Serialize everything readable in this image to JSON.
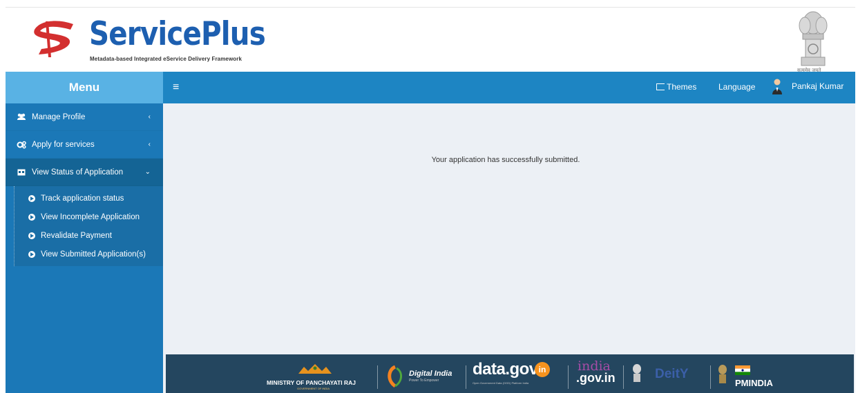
{
  "header": {
    "brand": "ServicePlus",
    "tagline": "Metadata-based Integrated eService Delivery Framework",
    "emblem_caption": "सत्यमेव जयते"
  },
  "sidebar": {
    "menu_title": "Menu",
    "items": [
      {
        "label": "Manage Profile",
        "icon": "users-icon",
        "expanded": false
      },
      {
        "label": "Apply for services",
        "icon": "gears-icon",
        "expanded": false
      },
      {
        "label": "View Status of Application",
        "icon": "window-icon",
        "expanded": true
      }
    ],
    "submenu": [
      {
        "label": "Track application status"
      },
      {
        "label": "View Incomplete Application"
      },
      {
        "label": "Revalidate Payment"
      },
      {
        "label": "View Submitted Application(s)"
      }
    ]
  },
  "topbar": {
    "themes_label": "Themes",
    "language_label": "Language",
    "user_name": "Pankaj Kumar"
  },
  "main": {
    "message": "Your application has successfully submitted."
  },
  "footer": {
    "partners": {
      "panchayati_raj": "MINISTRY OF PANCHAYATI RAJ",
      "panchayati_raj_sub": "GOVERNMENT OF INDIA",
      "digital_india": "Digital India",
      "digital_india_sub": "Power To Empower",
      "datagov": "data.gov",
      "datagov_badge": "in",
      "datagov_sub": "Open Government Data (OGD) Platform India",
      "indiagov_top": "india",
      "indiagov_bottom": ".gov.in",
      "deity": "DeitY",
      "pmindia": "PMINDIA"
    }
  },
  "colors": {
    "brand_blue": "#1d5fb0",
    "sidebar_blue": "#1b78b7",
    "menu_header_blue": "#59b2e4",
    "topbar_blue": "#1d85c3",
    "footer_navy": "#24465f",
    "content_bg": "#ecf0f5"
  }
}
